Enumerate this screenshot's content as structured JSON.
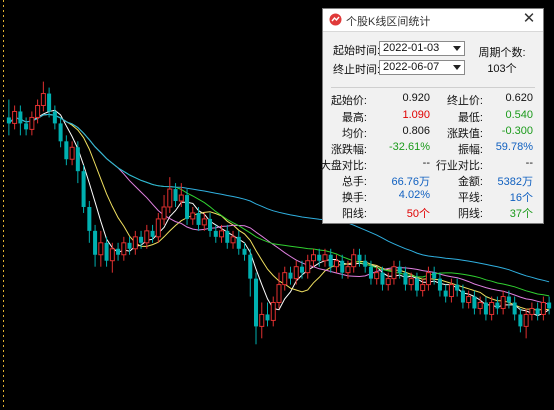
{
  "colors": {
    "up": "#e03030",
    "down": "#00b0b0",
    "ma5": "#ffffff",
    "ma10": "#f0e060",
    "ma20": "#e080e0",
    "ma30": "#30d030",
    "ma60": "#30b0e0",
    "red_text": "#e00000",
    "green_text": "#1a9a1a",
    "blue_text": "#1060c0"
  },
  "icons": {
    "app": "chart-logo-icon",
    "close": "close-icon",
    "dropdown": "chevron-down-icon"
  },
  "dialog": {
    "title": "个股K线区间统计",
    "close_label": "✕",
    "start_label": "起始时间:",
    "start_value": "2022-01-03",
    "end_label": "终止时间:",
    "end_value": "2022-06-07",
    "period_label": "周期个数:",
    "period_value": "103个"
  },
  "stats": {
    "start_price_label": "起始价:",
    "start_price": "0.920",
    "end_price_label": "终止价:",
    "end_price": "0.620",
    "high_label": "最高:",
    "high": "1.090",
    "low_label": "最低:",
    "low": "0.540",
    "avg_label": "均价:",
    "avg": "0.806",
    "change_value_label": "涨跌值:",
    "change_value": "-0.300",
    "change_pct_label": "涨跌幅:",
    "change_pct": "-32.61%",
    "amplitude_label": "振幅:",
    "amplitude": "59.78%",
    "market_cmp_label": "大盘对比:",
    "market_cmp": "--",
    "industry_cmp_label": "行业对比:",
    "industry_cmp": "--",
    "volume_label": "总手:",
    "volume": "66.76万",
    "amount_label": "金额:",
    "amount": "5382万",
    "turnover_label": "换手:",
    "turnover": "4.02%",
    "flat_label": "平线:",
    "flat": "16个",
    "up_label": "阳线:",
    "up": "50个",
    "down_label": "阴线:",
    "down": "37个"
  },
  "chart_data": {
    "type": "candlestick",
    "ylim": [
      0.45,
      1.12
    ],
    "candles": [
      {
        "o": 0.93,
        "c": 0.92,
        "h": 0.96,
        "l": 0.9
      },
      {
        "o": 0.92,
        "c": 0.94,
        "h": 0.95,
        "l": 0.91
      },
      {
        "o": 0.94,
        "c": 0.92,
        "h": 0.95,
        "l": 0.9
      },
      {
        "o": 0.92,
        "c": 0.91,
        "h": 0.93,
        "l": 0.9
      },
      {
        "o": 0.91,
        "c": 0.93,
        "h": 0.94,
        "l": 0.9
      },
      {
        "o": 0.93,
        "c": 0.95,
        "h": 0.96,
        "l": 0.92
      },
      {
        "o": 0.95,
        "c": 0.97,
        "h": 0.99,
        "l": 0.94
      },
      {
        "o": 0.97,
        "c": 0.94,
        "h": 0.98,
        "l": 0.93
      },
      {
        "o": 0.94,
        "c": 0.92,
        "h": 0.95,
        "l": 0.91
      },
      {
        "o": 0.92,
        "c": 0.89,
        "h": 0.93,
        "l": 0.88
      },
      {
        "o": 0.89,
        "c": 0.86,
        "h": 0.9,
        "l": 0.85
      },
      {
        "o": 0.86,
        "c": 0.88,
        "h": 0.89,
        "l": 0.85
      },
      {
        "o": 0.88,
        "c": 0.84,
        "h": 0.89,
        "l": 0.82
      },
      {
        "o": 0.84,
        "c": 0.78,
        "h": 0.85,
        "l": 0.77
      },
      {
        "o": 0.78,
        "c": 0.74,
        "h": 0.79,
        "l": 0.72
      },
      {
        "o": 0.74,
        "c": 0.7,
        "h": 0.75,
        "l": 0.68
      },
      {
        "o": 0.7,
        "c": 0.72,
        "h": 0.74,
        "l": 0.68
      },
      {
        "o": 0.72,
        "c": 0.69,
        "h": 0.73,
        "l": 0.68
      },
      {
        "o": 0.69,
        "c": 0.71,
        "h": 0.72,
        "l": 0.67
      },
      {
        "o": 0.71,
        "c": 0.7,
        "h": 0.72,
        "l": 0.69
      },
      {
        "o": 0.7,
        "c": 0.72,
        "h": 0.73,
        "l": 0.69
      },
      {
        "o": 0.72,
        "c": 0.71,
        "h": 0.73,
        "l": 0.7
      },
      {
        "o": 0.71,
        "c": 0.73,
        "h": 0.74,
        "l": 0.7
      },
      {
        "o": 0.73,
        "c": 0.72,
        "h": 0.74,
        "l": 0.71
      },
      {
        "o": 0.72,
        "c": 0.74,
        "h": 0.75,
        "l": 0.71
      },
      {
        "o": 0.74,
        "c": 0.73,
        "h": 0.75,
        "l": 0.72
      },
      {
        "o": 0.73,
        "c": 0.76,
        "h": 0.77,
        "l": 0.72
      },
      {
        "o": 0.76,
        "c": 0.78,
        "h": 0.8,
        "l": 0.75
      },
      {
        "o": 0.78,
        "c": 0.81,
        "h": 0.83,
        "l": 0.77
      },
      {
        "o": 0.81,
        "c": 0.79,
        "h": 0.82,
        "l": 0.78
      },
      {
        "o": 0.79,
        "c": 0.8,
        "h": 0.82,
        "l": 0.78
      },
      {
        "o": 0.8,
        "c": 0.76,
        "h": 0.81,
        "l": 0.75
      },
      {
        "o": 0.76,
        "c": 0.77,
        "h": 0.78,
        "l": 0.75
      },
      {
        "o": 0.77,
        "c": 0.75,
        "h": 0.78,
        "l": 0.74
      },
      {
        "o": 0.75,
        "c": 0.76,
        "h": 0.77,
        "l": 0.74
      },
      {
        "o": 0.76,
        "c": 0.74,
        "h": 0.77,
        "l": 0.73
      },
      {
        "o": 0.74,
        "c": 0.73,
        "h": 0.75,
        "l": 0.72
      },
      {
        "o": 0.73,
        "c": 0.74,
        "h": 0.75,
        "l": 0.72
      },
      {
        "o": 0.74,
        "c": 0.72,
        "h": 0.75,
        "l": 0.71
      },
      {
        "o": 0.72,
        "c": 0.73,
        "h": 0.74,
        "l": 0.71
      },
      {
        "o": 0.73,
        "c": 0.71,
        "h": 0.74,
        "l": 0.7
      },
      {
        "o": 0.71,
        "c": 0.7,
        "h": 0.72,
        "l": 0.69
      },
      {
        "o": 0.7,
        "c": 0.66,
        "h": 0.71,
        "l": 0.63
      },
      {
        "o": 0.66,
        "c": 0.58,
        "h": 0.67,
        "l": 0.55
      },
      {
        "o": 0.58,
        "c": 0.6,
        "h": 0.62,
        "l": 0.56
      },
      {
        "o": 0.6,
        "c": 0.59,
        "h": 0.62,
        "l": 0.58
      },
      {
        "o": 0.59,
        "c": 0.62,
        "h": 0.63,
        "l": 0.58
      },
      {
        "o": 0.62,
        "c": 0.65,
        "h": 0.67,
        "l": 0.61
      },
      {
        "o": 0.65,
        "c": 0.67,
        "h": 0.68,
        "l": 0.64
      },
      {
        "o": 0.67,
        "c": 0.66,
        "h": 0.68,
        "l": 0.65
      },
      {
        "o": 0.66,
        "c": 0.68,
        "h": 0.69,
        "l": 0.65
      },
      {
        "o": 0.68,
        "c": 0.67,
        "h": 0.69,
        "l": 0.66
      },
      {
        "o": 0.67,
        "c": 0.69,
        "h": 0.7,
        "l": 0.66
      },
      {
        "o": 0.69,
        "c": 0.7,
        "h": 0.71,
        "l": 0.68
      },
      {
        "o": 0.7,
        "c": 0.69,
        "h": 0.71,
        "l": 0.68
      },
      {
        "o": 0.69,
        "c": 0.7,
        "h": 0.71,
        "l": 0.68
      },
      {
        "o": 0.7,
        "c": 0.68,
        "h": 0.71,
        "l": 0.67
      },
      {
        "o": 0.68,
        "c": 0.69,
        "h": 0.7,
        "l": 0.67
      },
      {
        "o": 0.69,
        "c": 0.67,
        "h": 0.7,
        "l": 0.66
      },
      {
        "o": 0.67,
        "c": 0.68,
        "h": 0.69,
        "l": 0.66
      },
      {
        "o": 0.68,
        "c": 0.7,
        "h": 0.71,
        "l": 0.67
      },
      {
        "o": 0.7,
        "c": 0.69,
        "h": 0.71,
        "l": 0.68
      },
      {
        "o": 0.69,
        "c": 0.68,
        "h": 0.7,
        "l": 0.67
      },
      {
        "o": 0.68,
        "c": 0.66,
        "h": 0.69,
        "l": 0.65
      },
      {
        "o": 0.66,
        "c": 0.67,
        "h": 0.68,
        "l": 0.65
      },
      {
        "o": 0.67,
        "c": 0.65,
        "h": 0.68,
        "l": 0.64
      },
      {
        "o": 0.65,
        "c": 0.66,
        "h": 0.67,
        "l": 0.64
      },
      {
        "o": 0.66,
        "c": 0.68,
        "h": 0.69,
        "l": 0.65
      },
      {
        "o": 0.68,
        "c": 0.67,
        "h": 0.69,
        "l": 0.66
      },
      {
        "o": 0.67,
        "c": 0.65,
        "h": 0.68,
        "l": 0.64
      },
      {
        "o": 0.65,
        "c": 0.66,
        "h": 0.67,
        "l": 0.64
      },
      {
        "o": 0.66,
        "c": 0.64,
        "h": 0.67,
        "l": 0.63
      },
      {
        "o": 0.64,
        "c": 0.65,
        "h": 0.66,
        "l": 0.63
      },
      {
        "o": 0.65,
        "c": 0.67,
        "h": 0.68,
        "l": 0.64
      },
      {
        "o": 0.67,
        "c": 0.66,
        "h": 0.68,
        "l": 0.65
      },
      {
        "o": 0.66,
        "c": 0.64,
        "h": 0.67,
        "l": 0.63
      },
      {
        "o": 0.64,
        "c": 0.63,
        "h": 0.65,
        "l": 0.62
      },
      {
        "o": 0.63,
        "c": 0.65,
        "h": 0.66,
        "l": 0.62
      },
      {
        "o": 0.65,
        "c": 0.64,
        "h": 0.66,
        "l": 0.63
      },
      {
        "o": 0.64,
        "c": 0.62,
        "h": 0.65,
        "l": 0.61
      },
      {
        "o": 0.62,
        "c": 0.63,
        "h": 0.64,
        "l": 0.61
      },
      {
        "o": 0.63,
        "c": 0.61,
        "h": 0.64,
        "l": 0.6
      },
      {
        "o": 0.61,
        "c": 0.62,
        "h": 0.63,
        "l": 0.6
      },
      {
        "o": 0.62,
        "c": 0.6,
        "h": 0.63,
        "l": 0.59
      },
      {
        "o": 0.6,
        "c": 0.62,
        "h": 0.63,
        "l": 0.59
      },
      {
        "o": 0.62,
        "c": 0.61,
        "h": 0.63,
        "l": 0.6
      },
      {
        "o": 0.61,
        "c": 0.63,
        "h": 0.64,
        "l": 0.6
      },
      {
        "o": 0.63,
        "c": 0.62,
        "h": 0.64,
        "l": 0.61
      },
      {
        "o": 0.62,
        "c": 0.6,
        "h": 0.63,
        "l": 0.59
      },
      {
        "o": 0.6,
        "c": 0.58,
        "h": 0.61,
        "l": 0.57
      },
      {
        "o": 0.58,
        "c": 0.6,
        "h": 0.61,
        "l": 0.56
      },
      {
        "o": 0.6,
        "c": 0.61,
        "h": 0.62,
        "l": 0.59
      },
      {
        "o": 0.61,
        "c": 0.6,
        "h": 0.62,
        "l": 0.59
      },
      {
        "o": 0.6,
        "c": 0.62,
        "h": 0.63,
        "l": 0.59
      },
      {
        "o": 0.62,
        "c": 0.61,
        "h": 0.63,
        "l": 0.6
      }
    ],
    "ma_periods": [
      5,
      10,
      20,
      30,
      60
    ]
  }
}
